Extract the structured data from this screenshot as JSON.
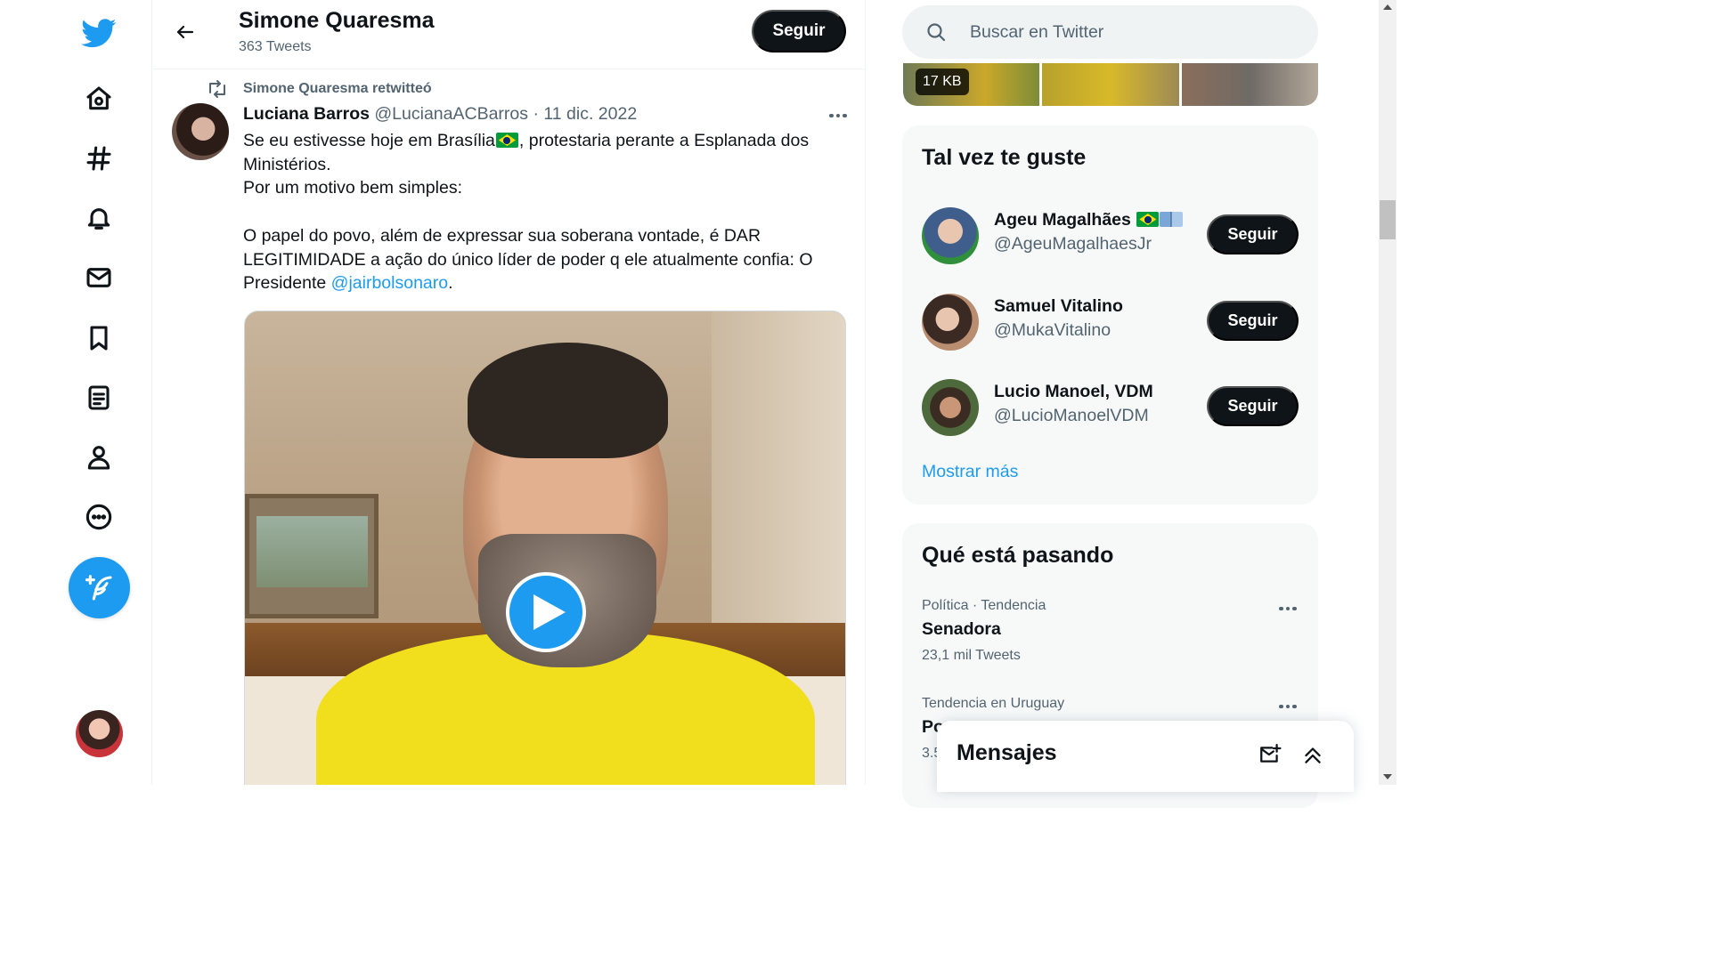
{
  "nav": {
    "items": [
      {
        "name": "twitter-logo-icon",
        "label": "Twitter"
      },
      {
        "name": "home-icon",
        "label": "Inicio"
      },
      {
        "name": "explore-hashtag-icon",
        "label": "Explorar"
      },
      {
        "name": "notifications-bell-icon",
        "label": "Notificaciones"
      },
      {
        "name": "messages-envelope-icon",
        "label": "Mensajes"
      },
      {
        "name": "bookmarks-icon",
        "label": "Guardados"
      },
      {
        "name": "lists-icon",
        "label": "Listas"
      },
      {
        "name": "profile-person-icon",
        "label": "Perfil"
      },
      {
        "name": "more-options-circle-icon",
        "label": "Más opciones"
      }
    ],
    "compose_icon": "compose-tweet-feather-icon",
    "account_avatar": "account-avatar",
    "accent": "#1d9bf0"
  },
  "header": {
    "name": "Simone Quaresma",
    "tweet_count": "363 Tweets",
    "follow_label": "Seguir"
  },
  "tweet": {
    "retweet_label": "Simone Quaresma retwitteó",
    "author_name": "Luciana Barros",
    "author_handle": "@LucianaACBarros",
    "separator": "·",
    "date": "11 dic. 2022",
    "body": {
      "line1_before_flag": "Se eu estivesse hoje em Brasília",
      "line1_after_flag": ", protestaria perante a Esplanada dos Ministérios.",
      "line2": "Por um motivo bem simples:",
      "line3_before_mention": "O papel do povo, além de expressar sua soberana vontade, é DAR LEGITIMIDADE a ação do único líder de poder q ele atualmente confia: O Presidente ",
      "mention": "@jairbolsonaro",
      "line3_after_mention": "."
    },
    "media": {
      "type": "video",
      "play_icon": "play-icon"
    }
  },
  "search": {
    "placeholder": "Buscar en Twitter"
  },
  "media_strip": {
    "badge": "17 KB"
  },
  "who_to_follow": {
    "title": "Tal vez te guste",
    "users": [
      {
        "name": "Ageu Magalhães",
        "handle": "@AgeuMagalhaesJr",
        "follow_label": "Seguir",
        "emoji": [
          "brazil-flag",
          "open-book"
        ]
      },
      {
        "name": "Samuel Vitalino",
        "handle": "@MukaVitalino",
        "follow_label": "Seguir"
      },
      {
        "name": "Lucio Manoel, VDM",
        "handle": "@LucioManoelVDM",
        "follow_label": "Seguir"
      }
    ],
    "show_more": "Mostrar más"
  },
  "trends": {
    "title": "Qué está pasando",
    "items": [
      {
        "context": "Política · Tendencia",
        "name": "Senadora",
        "count": "23,1 mil Tweets"
      },
      {
        "context": "Tendencia en Uruguay",
        "name": "Po",
        "count": "3.5"
      }
    ]
  },
  "messages_drawer": {
    "title": "Mensajes",
    "new_message_icon": "new-message-icon",
    "expand_icon": "expand-double-chevron-up-icon"
  }
}
